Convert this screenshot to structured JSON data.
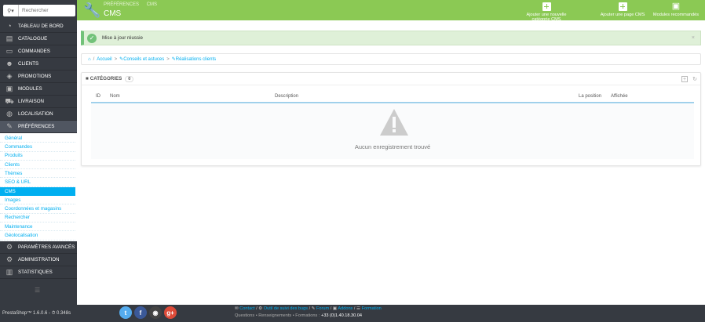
{
  "search": {
    "placeholder": "Rechercher"
  },
  "menu": {
    "top": [
      {
        "label": "TABLEAU DE BORD",
        "icon": "dashboard-icon"
      },
      {
        "label": "CATALOGUE",
        "icon": "catalog-icon"
      },
      {
        "label": "COMMANDES",
        "icon": "credit-card-icon"
      },
      {
        "label": "CLIENTS",
        "icon": "user-icon"
      },
      {
        "label": "PROMOTIONS",
        "icon": "tag-icon"
      },
      {
        "label": "MODULES",
        "icon": "puzzle-icon"
      },
      {
        "label": "LIVRAISON",
        "icon": "truck-icon"
      },
      {
        "label": "LOCALISATION",
        "icon": "globe-icon"
      },
      {
        "label": "PRÉFÉRENCES",
        "icon": "wrench-icon"
      }
    ],
    "sub": [
      "Général",
      "Commandes",
      "Produits",
      "Clients",
      "Thèmes",
      "SEO & URL",
      "CMS",
      "Images",
      "Coordonnées et magasins",
      "Rechercher",
      "Maintenance",
      "Géolocalisation"
    ],
    "bottom": [
      {
        "label": "PARAMÈTRES AVANCÉS",
        "icon": "cogs-icon"
      },
      {
        "label": "ADMINISTRATION",
        "icon": "cog-icon"
      },
      {
        "label": "STATISTIQUES",
        "icon": "bar-chart-icon"
      }
    ]
  },
  "header": {
    "crumb1": "PRÉFÉRENCES",
    "crumb2": "CMS",
    "title": "CMS",
    "btn_category": "Ajouter une nouvelle catégorie CMS",
    "btn_page": "Ajouter une page CMS",
    "btn_modules": "Modules recommandés"
  },
  "alert": {
    "message": "Mise à jour réussie",
    "close": "×"
  },
  "breadcrumb": {
    "home": "Accueil",
    "item1": "Conseils et astuces",
    "item2": "Réalisations clients"
  },
  "panel": {
    "title": "CATÉGORIES",
    "count": "0",
    "columns": {
      "id": "ID",
      "name": "Nom",
      "description": "Description",
      "position": "La position",
      "displayed": "Affichée"
    },
    "empty": "Aucun enregistrement trouvé"
  },
  "footer": {
    "version": "PrestaShop™ 1.6.0.6 - ⏱ 0.348s",
    "contact": "Contact",
    "bugs": "Outil de suivi des bugs",
    "forum": "Forum",
    "addons": "Addons",
    "training": "Formation",
    "line2": "Questions • Renseignements • Formations :",
    "phone": "+33 (0)1.40.18.30.04",
    "social": [
      {
        "icon": "twitter-icon",
        "glyph": "t",
        "color": "#55acee"
      },
      {
        "icon": "facebook-icon",
        "glyph": "f",
        "color": "#3b5998"
      },
      {
        "icon": "github-icon",
        "glyph": "◉",
        "color": "#444"
      },
      {
        "icon": "googleplus-icon",
        "glyph": "g+",
        "color": "#dd4b39"
      }
    ]
  }
}
